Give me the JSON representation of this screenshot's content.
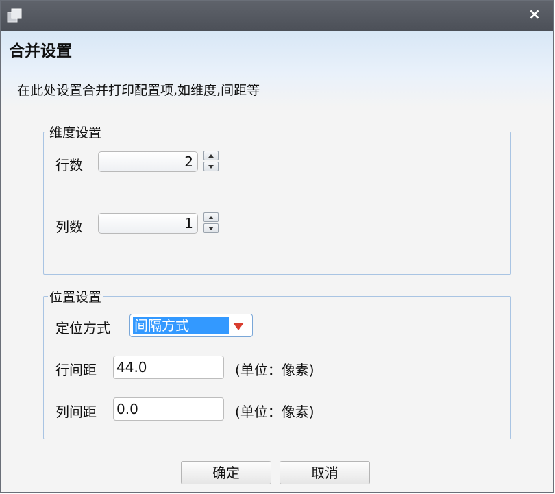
{
  "window": {
    "close_icon": "×"
  },
  "header": {
    "title": "合并设置",
    "description": "在此处设置合并打印配置项,如维度,间距等"
  },
  "dimension_group": {
    "legend": "维度设置",
    "rows_label": "行数",
    "rows_value": "2",
    "cols_label": "列数",
    "cols_value": "1"
  },
  "position_group": {
    "legend": "位置设置",
    "mode_label": "定位方式",
    "mode_value": "间隔方式",
    "row_spacing_label": "行间距",
    "row_spacing_value": "44.0",
    "col_spacing_label": "列间距",
    "col_spacing_value": "0.0",
    "unit_text": "(单位：像素)"
  },
  "buttons": {
    "ok_label": "确定",
    "cancel_label": "取消"
  },
  "colors": {
    "titlebar": "#52565e",
    "selection": "#3399ff",
    "dropdown_arrow": "#d93c2e",
    "group_border": "#a9c4e3"
  }
}
